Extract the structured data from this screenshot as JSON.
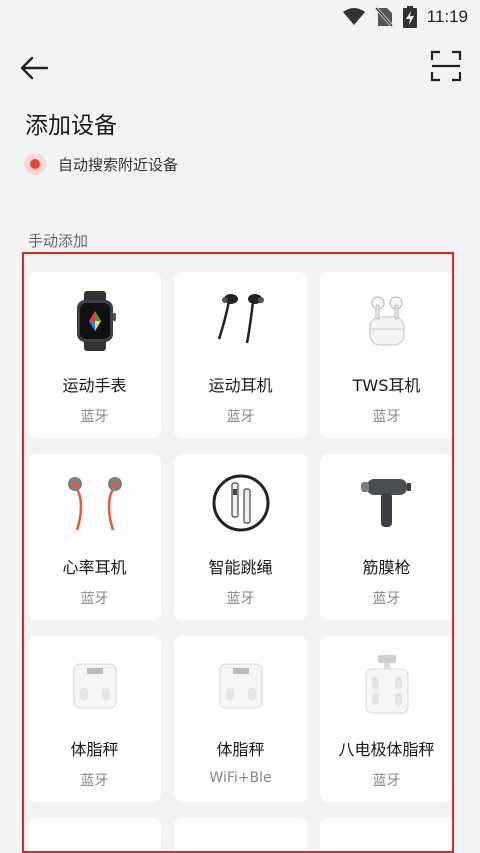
{
  "status_bar": {
    "time": "11:19",
    "icons": [
      "wifi-icon",
      "no-sim-icon",
      "battery-charging-icon"
    ]
  },
  "appbar": {
    "back_icon": "back-arrow-icon",
    "scan_icon": "scan-icon"
  },
  "page_title": "添加设备",
  "auto_search": {
    "label": "自动搜索附近设备",
    "accent": "#e8462f"
  },
  "manual_section": {
    "label": "手动添加"
  },
  "devices": [
    {
      "name": "运动手表",
      "connection": "蓝牙",
      "icon": "smartwatch-icon"
    },
    {
      "name": "运动耳机",
      "connection": "蓝牙",
      "icon": "sport-earphones-icon"
    },
    {
      "name": "TWS耳机",
      "connection": "蓝牙",
      "icon": "tws-earbuds-icon"
    },
    {
      "name": "心率耳机",
      "connection": "蓝牙",
      "icon": "heart-rate-earphones-icon"
    },
    {
      "name": "智能跳绳",
      "connection": "蓝牙",
      "icon": "jump-rope-icon"
    },
    {
      "name": "筋膜枪",
      "connection": "蓝牙",
      "icon": "massage-gun-icon"
    },
    {
      "name": "体脂秤",
      "connection": "蓝牙",
      "icon": "body-fat-scale-icon"
    },
    {
      "name": "体脂秤",
      "connection": "WiFi+Ble",
      "icon": "body-fat-scale-icon"
    },
    {
      "name": "八电极体脂秤",
      "connection": "蓝牙",
      "icon": "eight-electrode-scale-icon"
    }
  ]
}
